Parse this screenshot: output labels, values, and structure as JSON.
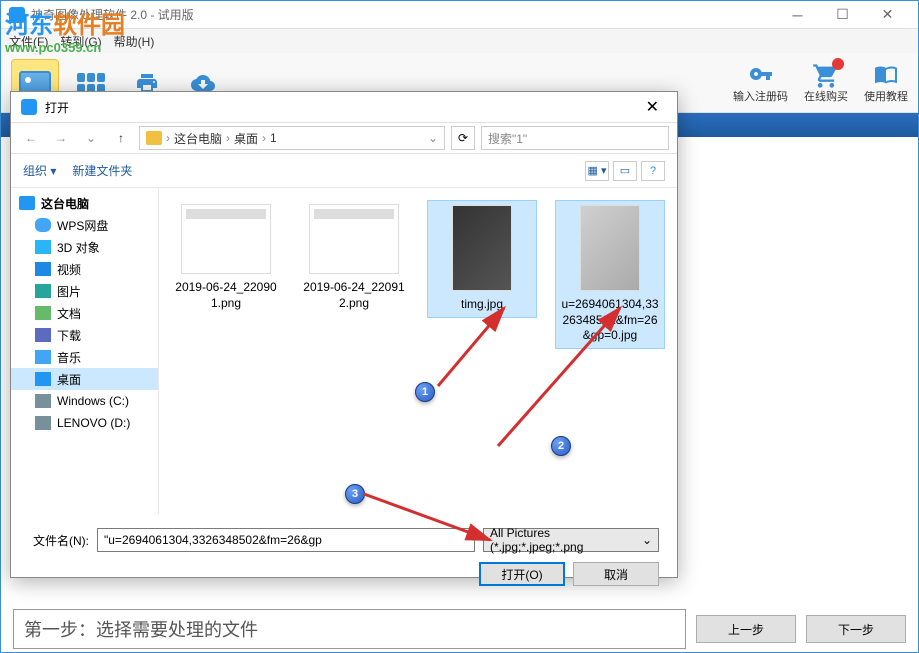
{
  "app": {
    "title": "神奇图像处理软件 2.0 - 试用版"
  },
  "watermark": {
    "text_part1": "河东",
    "text_part2": "软件园",
    "url": "www.pc0359.cn"
  },
  "menu": {
    "file": "文件(F)",
    "goto": "转到(G)",
    "help": "帮助(H)"
  },
  "toolbar_right": {
    "register": "输入注册码",
    "buy": "在线购买",
    "tutorial": "使用教程"
  },
  "bottom": {
    "step_text": "第一步：选择需要处理的文件",
    "prev": "上一步",
    "next": "下一步"
  },
  "dialog": {
    "title": "打开",
    "breadcrumb": {
      "root": "这台电脑",
      "desktop": "桌面",
      "folder": "1"
    },
    "search_placeholder": "搜索\"1\"",
    "organize": "组织 ▾",
    "new_folder": "新建文件夹",
    "sidebar": [
      {
        "label": "这台电脑",
        "icon": "pc",
        "bold": true
      },
      {
        "label": "WPS网盘",
        "icon": "cloud",
        "indent": true
      },
      {
        "label": "3D 对象",
        "icon": "3d",
        "indent": true
      },
      {
        "label": "视频",
        "icon": "video",
        "indent": true
      },
      {
        "label": "图片",
        "icon": "pic",
        "indent": true
      },
      {
        "label": "文档",
        "icon": "doc",
        "indent": true
      },
      {
        "label": "下载",
        "icon": "down",
        "indent": true
      },
      {
        "label": "音乐",
        "icon": "music",
        "indent": true
      },
      {
        "label": "桌面",
        "icon": "desktop",
        "indent": true,
        "selected": true
      },
      {
        "label": "Windows (C:)",
        "icon": "disk",
        "indent": true
      },
      {
        "label": "LENOVO (D:)",
        "icon": "disk",
        "indent": true
      }
    ],
    "files": [
      {
        "name": "2019-06-24_220901.png",
        "type": "screenshot"
      },
      {
        "name": "2019-06-24_220912.png",
        "type": "screenshot"
      },
      {
        "name": "timg.jpg",
        "type": "photo",
        "selected": true
      },
      {
        "name": "u=2694061304,3326348502&fm=26&gp=0.jpg",
        "type": "photo2",
        "selected": true
      }
    ],
    "filename_label": "文件名(N):",
    "filename_value": "\"u=2694061304,3326348502&fm=26&gp",
    "filetype": "All Pictures (*.jpg;*.jpeg;*.png",
    "open_btn": "打开(O)",
    "cancel_btn": "取消"
  },
  "annotations": {
    "num1": "1",
    "num2": "2",
    "num3": "3"
  }
}
